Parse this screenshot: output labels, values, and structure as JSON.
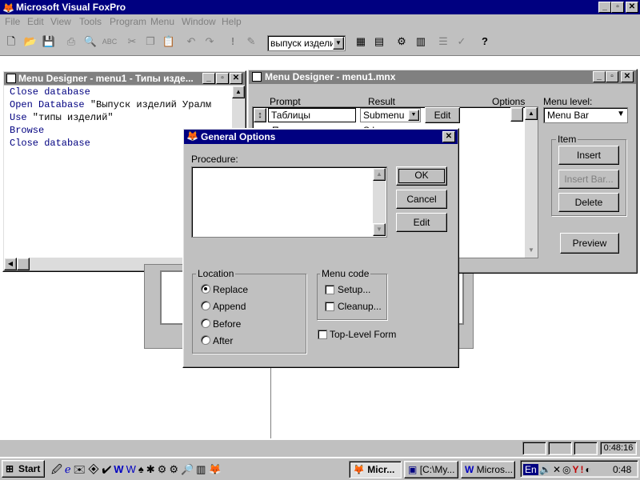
{
  "app": {
    "title": "Microsoft Visual FoxPro",
    "controls": {
      "minimize": "_",
      "maximize": "▫",
      "close": "✕"
    }
  },
  "menubar": [
    "File",
    "Edit",
    "View",
    "Tools",
    "Program",
    "Menu",
    "Window",
    "Help"
  ],
  "toolbar": {
    "combo_value": "выпуск издели",
    "icons": [
      "new-icon",
      "open-icon",
      "save-icon",
      "print-icon",
      "print-preview-icon",
      "spell-check-icon",
      "cut-icon",
      "copy-icon",
      "paste-icon",
      "undo-icon",
      "redo-icon",
      "run-icon",
      "modify-form-icon",
      "data-session-icon",
      "form-designer-icon",
      "form-wizard-icon",
      "report-designer-icon",
      "menu-designer-icon",
      "help-icon"
    ]
  },
  "code_window": {
    "title": "Menu Designer - menu1 - Типы изде...",
    "lines": [
      {
        "kw": "Close database",
        "rest": ""
      },
      {
        "kw": "Open Database",
        "rest": " \"Выпуск изделий Уралм"
      },
      {
        "kw": "Use",
        "rest": " \"типы изделий\""
      },
      {
        "kw": "Browse",
        "rest": ""
      },
      {
        "kw": "Close database",
        "rest": ""
      }
    ]
  },
  "menu_designer": {
    "title": "Menu Designer - menu1.mnx",
    "headers": {
      "prompt": "Prompt",
      "result": "Result",
      "options": "Options",
      "menu_level": "Menu level:"
    },
    "row": {
      "prompt": "Таблицы",
      "result": "Submenu",
      "edit": "Edit"
    },
    "row2_fragment": {
      "prompt": "П",
      "result": "S b"
    },
    "menu_level_value": "Menu Bar",
    "item_group": "Item",
    "buttons": {
      "insert": "Insert",
      "insert_bar": "Insert Bar...",
      "delete": "Delete",
      "preview": "Preview"
    }
  },
  "dialog": {
    "title": "General Options",
    "close": "✕",
    "procedure_label": "Procedure:",
    "buttons": {
      "ok": "OK",
      "cancel": "Cancel",
      "edit": "Edit"
    },
    "location": {
      "label": "Location",
      "options": [
        "Replace",
        "Append",
        "Before",
        "After"
      ],
      "selected": "Replace"
    },
    "menu_code": {
      "label": "Menu code",
      "setup": "Setup...",
      "cleanup": "Cleanup..."
    },
    "top_level_form": "Top-Level Form"
  },
  "statusbar": {
    "time": "0:48:16"
  },
  "taskbar": {
    "start": "Start",
    "quicklaunch": [
      "show-desktop-icon",
      "ie-icon",
      "outlook-icon",
      "channels-icon",
      "mail-icon",
      "word-icon",
      "word-doc-icon",
      "cards-icon",
      "msn-icon",
      "network-icon",
      "network2-icon",
      "search-icon",
      "book-icon",
      "foxpro-icon"
    ],
    "tasks": [
      {
        "label": "Micr...",
        "active": true
      },
      {
        "label": "[C:\\My...",
        "active": false
      },
      {
        "label": "Micros...",
        "active": false
      }
    ],
    "tray": {
      "lang": "En",
      "clock": "0:48"
    }
  }
}
